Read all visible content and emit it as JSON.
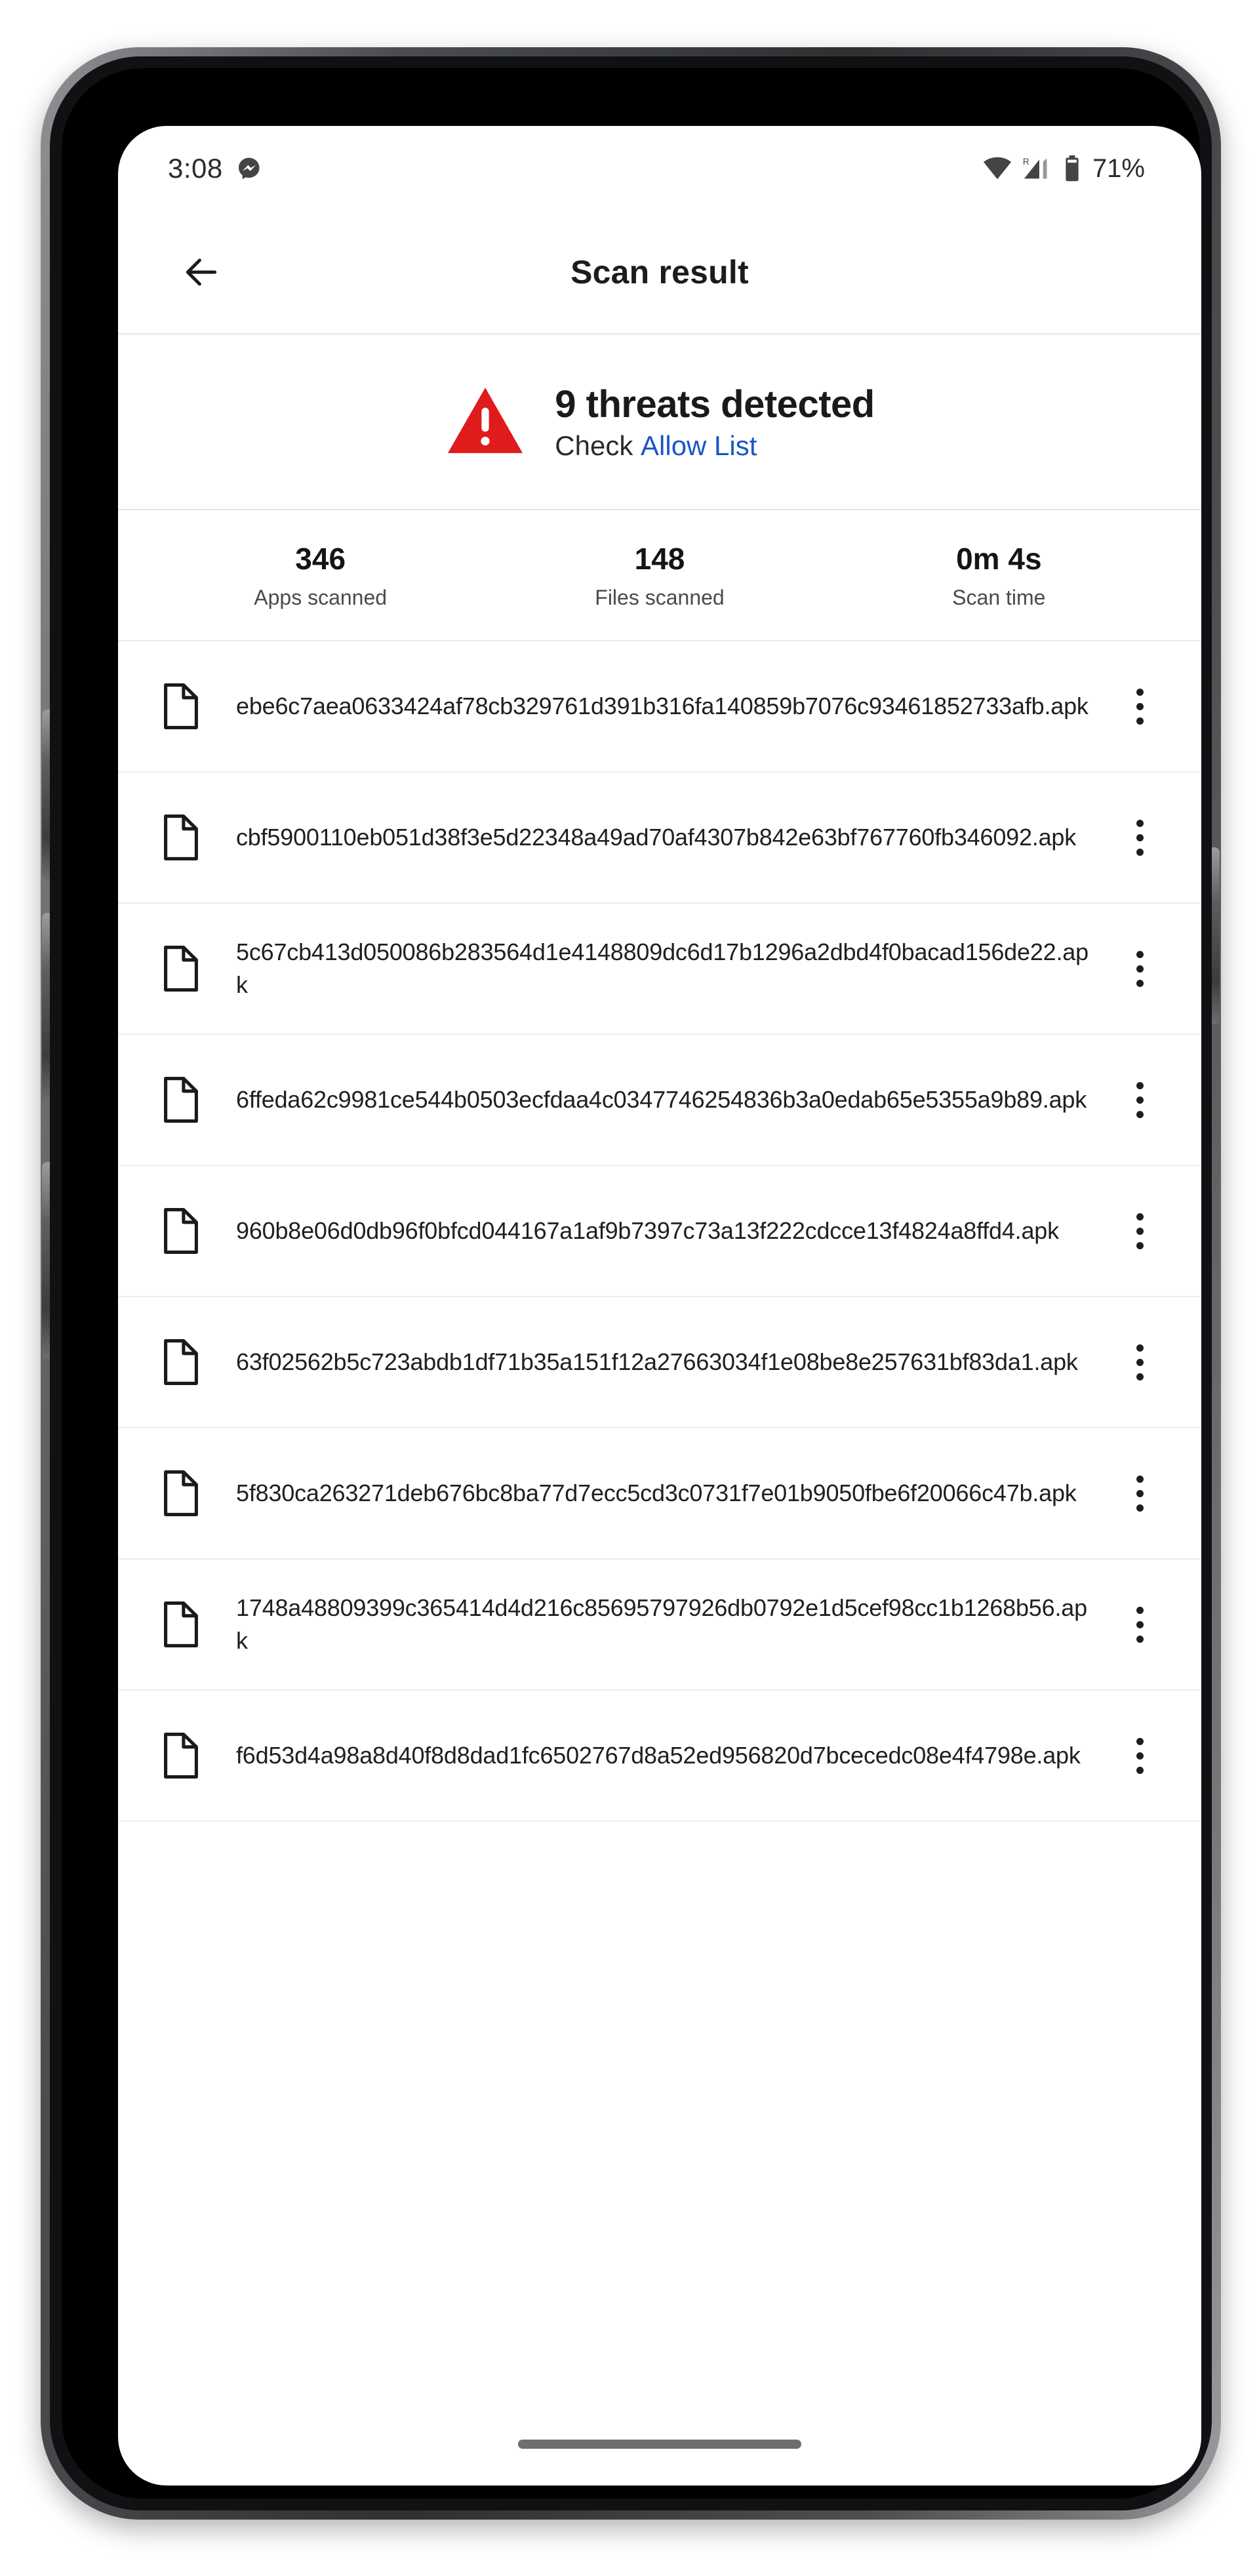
{
  "status_bar": {
    "time": "3:08",
    "app_icon": "messenger-icon",
    "wifi_icon": "wifi-icon",
    "signal_icon": "cellular-signal-icon",
    "signal_superscript": "R",
    "battery_icon": "battery-icon",
    "battery_text": "71%"
  },
  "app_bar": {
    "back_icon": "back-arrow-icon",
    "title": "Scan result"
  },
  "summary": {
    "warning_icon": "warning-triangle-icon",
    "title": "9 threats detected",
    "sub_prefix": "Check ",
    "sub_link": "Allow List",
    "warning_color": "#e01b1b",
    "link_color": "#1a56c4"
  },
  "stats": [
    {
      "value": "346",
      "label": "Apps scanned"
    },
    {
      "value": "148",
      "label": "Files scanned"
    },
    {
      "value": "0m 4s",
      "label": "Scan time"
    }
  ],
  "threats": [
    {
      "file_icon": "document-icon",
      "name": "ebe6c7aea0633424af78cb329761d391b316fa140859b7076c93461852733afb.apk",
      "more_icon": "overflow-menu-icon"
    },
    {
      "file_icon": "document-icon",
      "name": "cbf5900110eb051d38f3e5d22348a49ad70af4307b842e63bf767760fb346092.apk",
      "more_icon": "overflow-menu-icon"
    },
    {
      "file_icon": "document-icon",
      "name": "5c67cb413d050086b283564d1e4148809dc6d17b1296a2dbd4f0bacad156de22.apk",
      "more_icon": "overflow-menu-icon"
    },
    {
      "file_icon": "document-icon",
      "name": "6ffeda62c9981ce544b0503ecfdaa4c0347746254836b3a0edab65e5355a9b89.apk",
      "more_icon": "overflow-menu-icon"
    },
    {
      "file_icon": "document-icon",
      "name": "960b8e06d0db96f0bfcd044167a1af9b7397c73a13f222cdcce13f4824a8ffd4.apk",
      "more_icon": "overflow-menu-icon"
    },
    {
      "file_icon": "document-icon",
      "name": "63f02562b5c723abdb1df71b35a151f12a27663034f1e08be8e257631bf83da1.apk",
      "more_icon": "overflow-menu-icon"
    },
    {
      "file_icon": "document-icon",
      "name": "5f830ca263271deb676bc8ba77d7ecc5cd3c0731f7e01b9050fbe6f20066c47b.apk",
      "more_icon": "overflow-menu-icon"
    },
    {
      "file_icon": "document-icon",
      "name": "1748a48809399c365414d4d216c85695797926db0792e1d5cef98cc1b1268b56.apk",
      "more_icon": "overflow-menu-icon"
    },
    {
      "file_icon": "document-icon",
      "name": "f6d53d4a98a8d40f8d8dad1fc6502767d8a52ed956820d7bcecedc08e4f4798e.apk",
      "more_icon": "overflow-menu-icon"
    }
  ],
  "home_indicator": "home-indicator"
}
